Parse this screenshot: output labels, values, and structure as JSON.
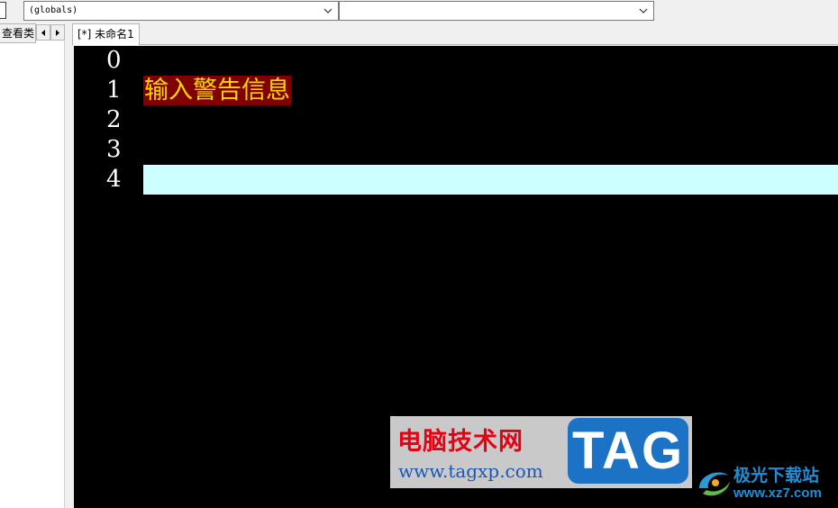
{
  "toolbar": {
    "object_combo_value": "(globals)",
    "proc_combo_value": ""
  },
  "left_panel": {
    "tab_label": "查看类"
  },
  "document": {
    "tab_label": "[*] 未命名1"
  },
  "editor": {
    "lines": [
      {
        "number": "0",
        "text": ""
      },
      {
        "number": "1",
        "text": "输入警告信息"
      },
      {
        "number": "2",
        "text": ""
      },
      {
        "number": "3",
        "text": ""
      },
      {
        "number": "4",
        "text": ""
      }
    ],
    "colors": {
      "background": "#000000",
      "line_number": "#ffffff",
      "text_background": "#800000",
      "text_color": "#ffd700",
      "current_line": "#ccffff"
    }
  },
  "watermark": {
    "title": "电脑技术网",
    "url": "www.tagxp.com",
    "tag": "TAG"
  },
  "watermark2": {
    "title": "极光下载站",
    "url": "www.xz7.com"
  }
}
